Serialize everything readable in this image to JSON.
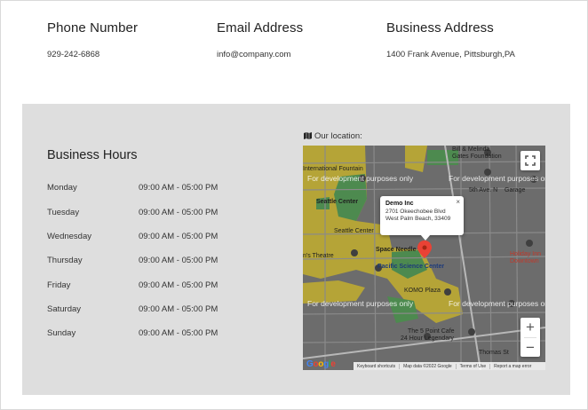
{
  "contact": [
    {
      "label": "Phone Number",
      "value": "929-242-6868"
    },
    {
      "label": "Email Address",
      "value": "info@company.com"
    },
    {
      "label": "Business Address",
      "value": "1400 Frank Avenue, Pittsburgh,PA"
    }
  ],
  "hours": {
    "title": "Business Hours",
    "rows": [
      {
        "day": "Monday",
        "time": "09:00 AM - 05:00 PM"
      },
      {
        "day": "Tuesday",
        "time": "09:00 AM - 05:00 PM"
      },
      {
        "day": "Wednesday",
        "time": "09:00 AM - 05:00 PM"
      },
      {
        "day": "Thursday",
        "time": "09:00 AM - 05:00 PM"
      },
      {
        "day": "Friday",
        "time": "09:00 AM - 05:00 PM"
      },
      {
        "day": "Saturday",
        "time": "09:00 AM - 05:00 PM"
      },
      {
        "day": "Sunday",
        "time": "09:00 AM - 05:00 PM"
      }
    ]
  },
  "location": {
    "label": "Our location:",
    "icon": "map-icon"
  },
  "map": {
    "watermark": "For development purposes only",
    "popup": {
      "title": "Demo Inc",
      "line1": "2701 Okeechobee Blvd",
      "line2": "West Palm Beach, 33409",
      "close": "×"
    },
    "labels": {
      "intl_fountain": "International Fountain",
      "melinda": "Bill & Melinda",
      "gates": "Gates Foundation",
      "seattle_center": "Seattle Center",
      "seattle_center2": "Seattle Center",
      "space_needle": "Space Needle",
      "pacific_science": "Pacific Science Center",
      "childrens": "n's Theatre",
      "ave_n": "5th Ave. N",
      "garage": "Garage",
      "holiday_inn": "Holiday Inn",
      "downtown": "Downtown",
      "komo": "KOMO Plaza",
      "point_cafe": "The 5 Point Cafe",
      "legendary": "24 Hour Legendary",
      "thomas": "Thomas St"
    },
    "zoom_in": "+",
    "zoom_out": "−",
    "google": [
      "G",
      "o",
      "o",
      "g",
      "l",
      "e"
    ],
    "footer": {
      "shortcuts": "Keyboard shortcuts",
      "mapdata": "Map data ©2022 Google",
      "terms": "Terms of Use",
      "report": "Report a map error"
    }
  },
  "colors": {
    "section_bg": "#dedede",
    "map_yellow": "#b5a437",
    "map_green": "#4d8a4f",
    "map_gray": "#6c6c6c",
    "pin_red": "#e94235"
  }
}
